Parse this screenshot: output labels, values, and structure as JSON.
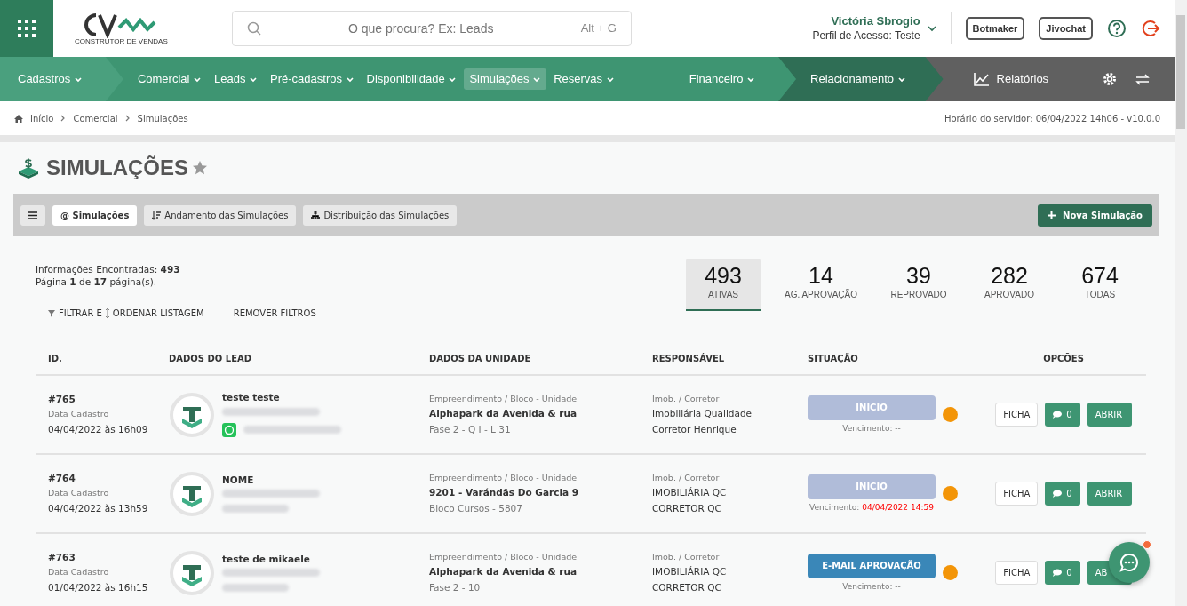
{
  "header": {
    "search": {
      "placeholder": "O que procura? Ex: Leads",
      "shortcut": "Alt + G"
    },
    "user": {
      "name": "Victória Sbrogio",
      "profile": "Perfil de Acesso: Teste"
    },
    "buttons": [
      "Botmaker",
      "Jivochat"
    ],
    "logo_tagline": "CONSTRUTOR DE VENDAS"
  },
  "nav": [
    {
      "label": "Cadastros",
      "kind": "first",
      "selected": false
    },
    {
      "label": "Comercial",
      "kind": "main",
      "selected": false
    },
    {
      "label": "Leads",
      "kind": "main",
      "selected": false
    },
    {
      "label": "Pré-cadastros",
      "kind": "main",
      "selected": false
    },
    {
      "label": "Disponibilidade",
      "kind": "main",
      "selected": false
    },
    {
      "label": "Simulações",
      "kind": "main",
      "selected": true
    },
    {
      "label": "Reservas",
      "kind": "main",
      "selected": false
    },
    {
      "label": "Financeiro",
      "kind": "fin",
      "selected": false
    },
    {
      "label": "Relacionamento",
      "kind": "rel",
      "selected": false
    }
  ],
  "reports": "Relatórios",
  "breadcrumb": [
    "Início",
    "Comercial",
    "Simulações"
  ],
  "server_time": "Horário do servidor: 06/04/2022 14h06 - v10.0.0",
  "title": "SIMULAÇÕES",
  "tabs": [
    {
      "label": "@ Simulações",
      "selected": true
    },
    {
      "label": "Andamento das Simulações",
      "selected": false
    },
    {
      "label": "Distribuição das Simulações",
      "selected": false
    }
  ],
  "new_button": "Nova Simulação",
  "info": {
    "found_label": "Informações Encontradas:",
    "found": "493",
    "page_text": "Página **1** de **17** página(s)."
  },
  "filters": [
    "FILTRAR E",
    "ORDENAR LISTAGEM",
    "REMOVER FILTROS"
  ],
  "stats": [
    {
      "value": "493",
      "label": "ATIVAS",
      "selected": true
    },
    {
      "value": "14",
      "label": "AG. APROVAÇÃO",
      "selected": false
    },
    {
      "value": "39",
      "label": "REPROVADO",
      "selected": false
    },
    {
      "value": "282",
      "label": "APROVADO",
      "selected": false
    },
    {
      "value": "674",
      "label": "TODAS",
      "selected": false
    }
  ],
  "table": {
    "columns": [
      "ID.",
      "DADOS DO LEAD",
      "DADOS DA UNIDADE",
      "RESPONSÁVEL",
      "SITUAÇÃO",
      "OPCÕES"
    ],
    "rows": [
      {
        "id": "#765",
        "date_label": "Data Cadastro",
        "date": "04/04/2022 às 16h09",
        "lead": "teste teste",
        "whatsapp": true,
        "unit_label": "Empreendimento / Bloco - Unidade",
        "unit": "Alphapark da Avenida & rua",
        "unit_detail": "Fase 2 - Q I - L 31",
        "resp_label": "Imob. / Corretor",
        "agency": "Imobiliária Qualidade",
        "broker": "Corretor Henrique",
        "status": "INICIO",
        "color": "#b0bcd9",
        "due_label": "Vencimento:",
        "due": "--",
        "overdue": false,
        "actions": [
          "FICHA",
          "0",
          "ABRIR"
        ]
      },
      {
        "id": "#764",
        "date_label": "Data Cadastro",
        "date": "04/04/2022 às 13h59",
        "lead": "NOME",
        "whatsapp": false,
        "unit_label": "Empreendimento / Bloco - Unidade",
        "unit": "9201 - Varándãs Do Garcia 9",
        "unit_detail": "Bloco Cursos - 5807",
        "resp_label": "Imob. / Corretor",
        "agency": "IMOBILIÁRIA QC",
        "broker": "CORRETOR QC",
        "status": "INICIO",
        "color": "#b0bcd9",
        "due_label": "Vencimento:",
        "due": "04/04/2022 14:59",
        "overdue": true,
        "actions": [
          "FICHA",
          "0",
          "ABRIR"
        ]
      },
      {
        "id": "#763",
        "date_label": "Data Cadastro",
        "date": "01/04/2022 às 16h15",
        "lead": "teste de mikaele",
        "whatsapp": false,
        "unit_label": "Empreendimento / Bloco - Unidade",
        "unit": "Alphapark da Avenida & rua",
        "unit_detail": "Fase 2 - 10",
        "resp_label": "Imob. / Corretor",
        "agency": "IMOBILIÁRIA QC",
        "broker": "CORRETOR QC",
        "status": "E-MAIL APROVAÇÃO",
        "color": "#3a87b8",
        "due_label": "Vencimento:",
        "due": "--",
        "overdue": false,
        "actions": [
          "FICHA",
          "0",
          "AB"
        ]
      }
    ]
  }
}
